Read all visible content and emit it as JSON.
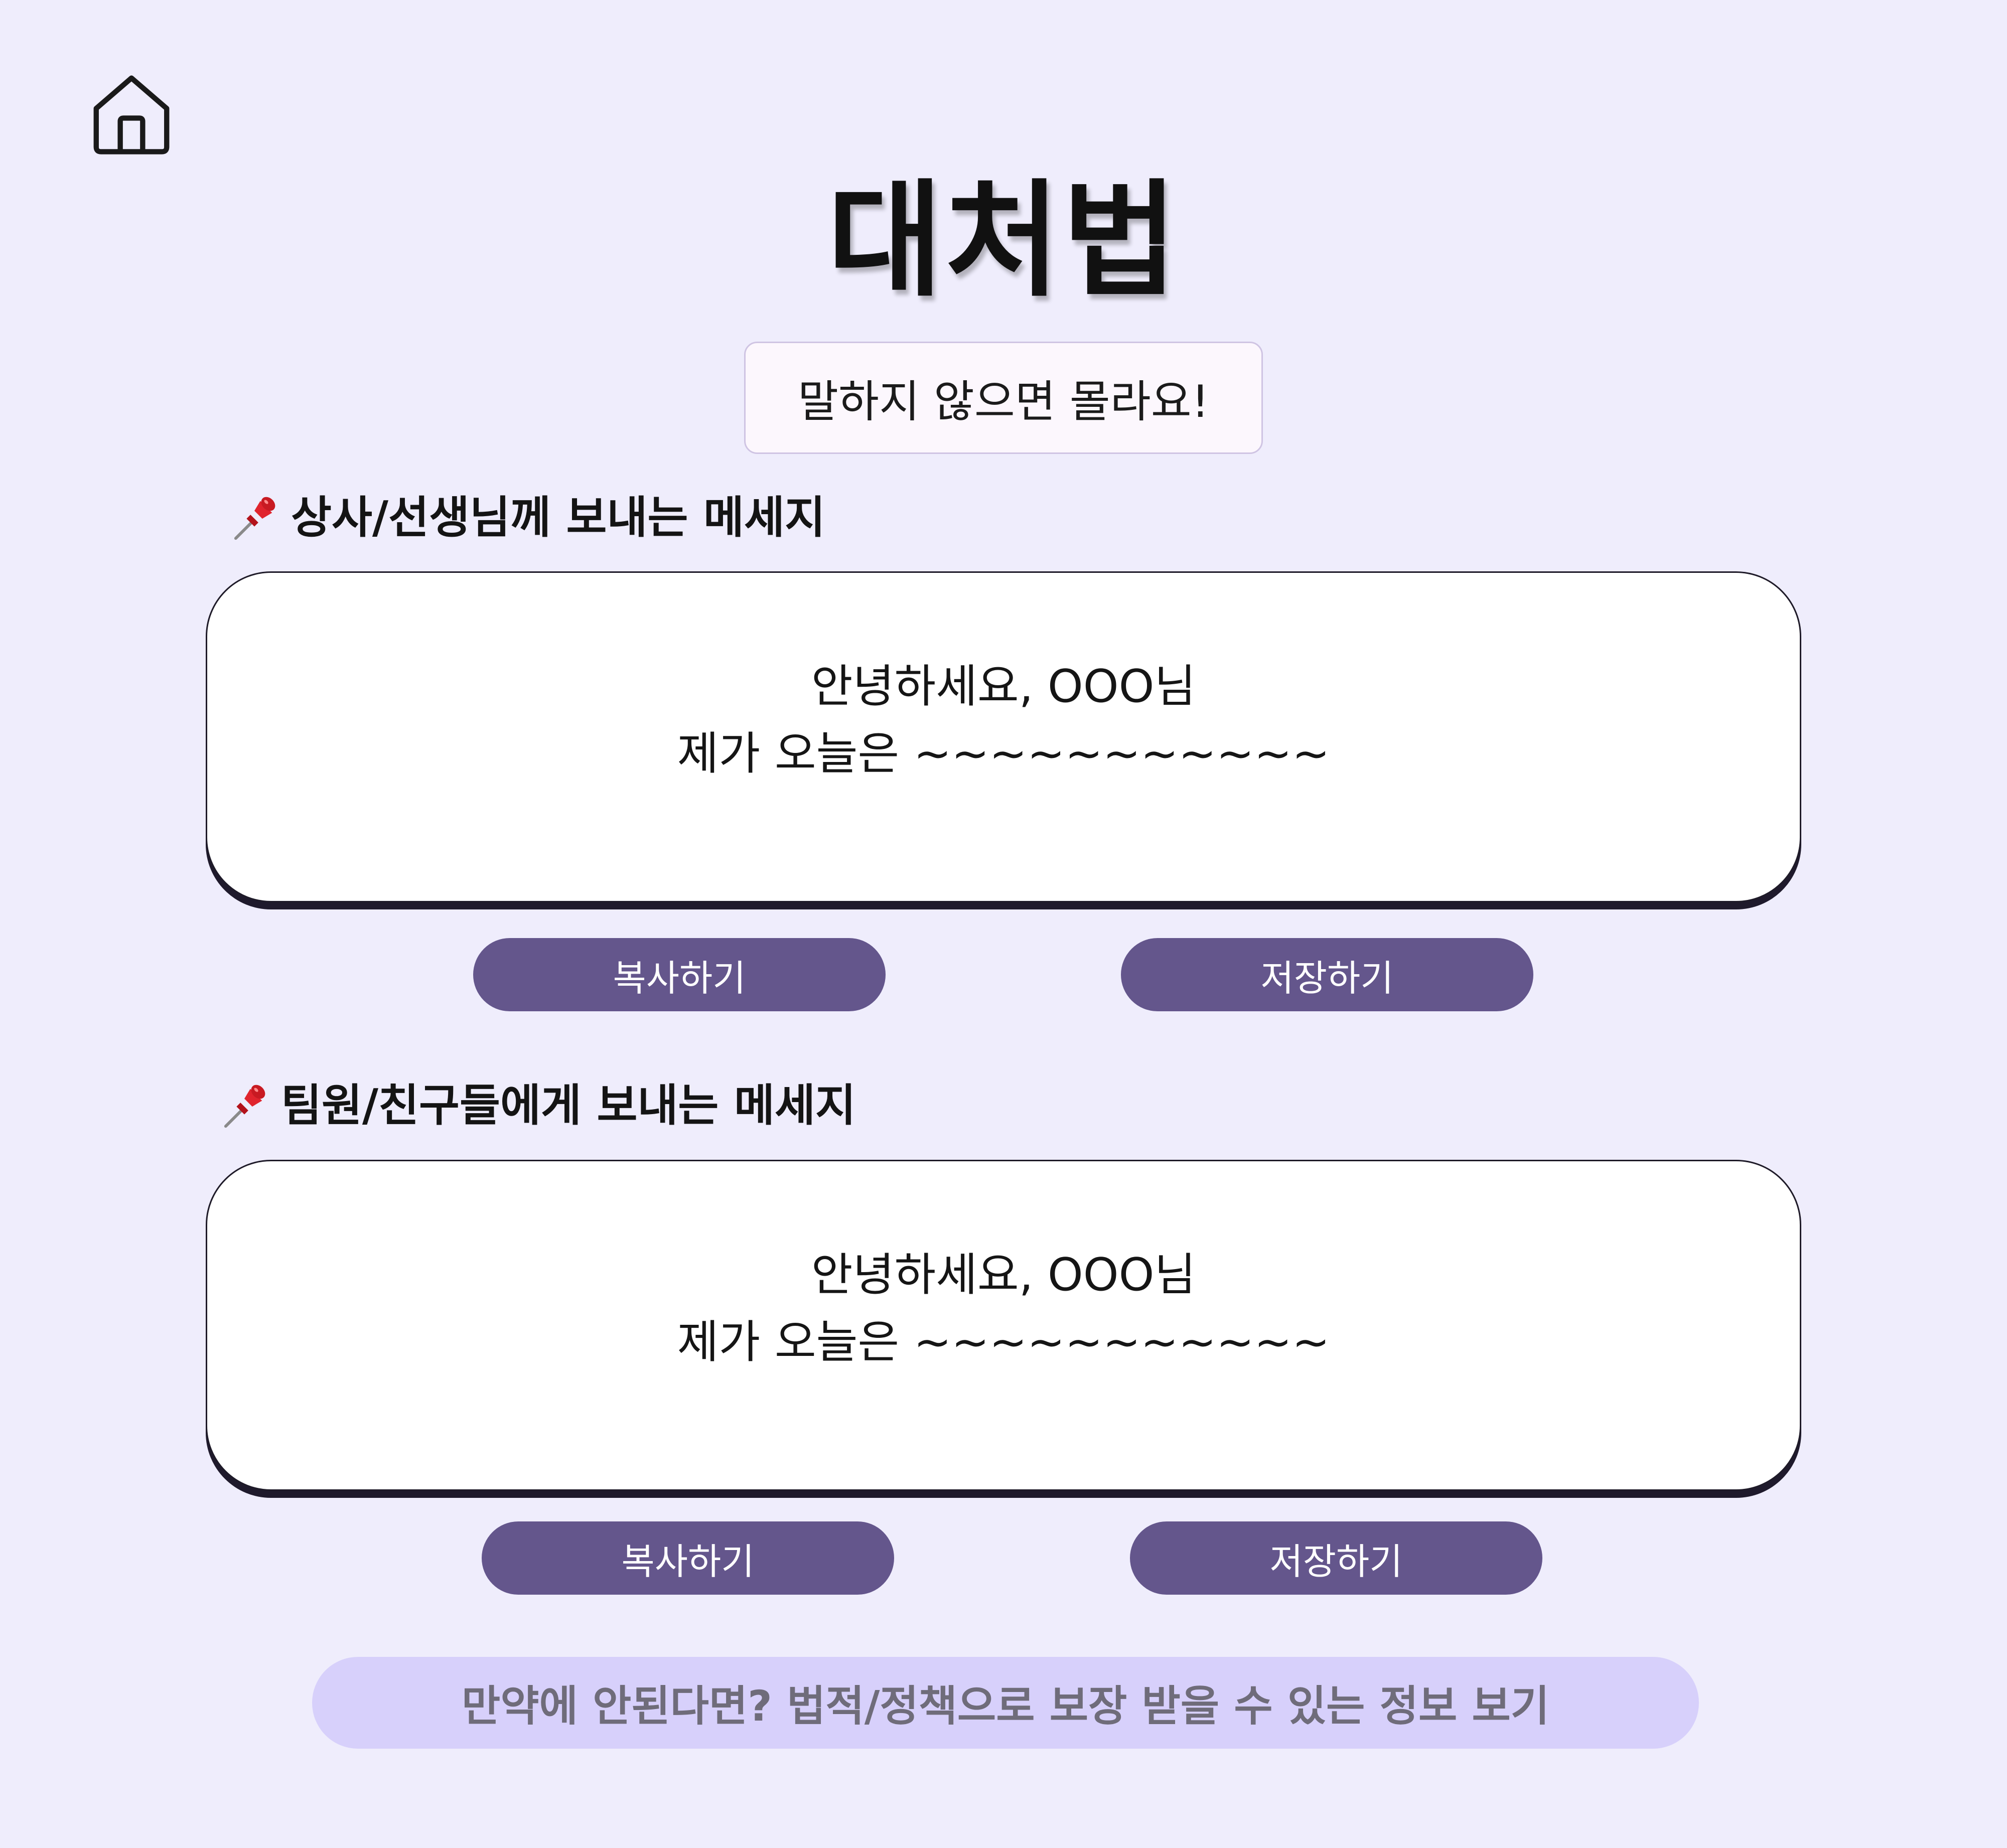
{
  "header": {
    "home_icon": "home-icon",
    "title": "대처법",
    "subtitle": "말하지 않으면 몰라요!"
  },
  "sections": [
    {
      "icon": "pushpin-icon",
      "heading": "상사/선생님께 보내는 메세지",
      "message_lines": [
        "안녕하세요, OOO님",
        "제가 오늘은 ~~~~~~~~~~~"
      ],
      "copy_label": "복사하기",
      "save_label": "저장하기"
    },
    {
      "icon": "pushpin-icon",
      "heading": "팀원/친구들에게 보내는 메세지",
      "message_lines": [
        "안녕하세요, OOO님",
        "제가 오늘은 ~~~~~~~~~~~"
      ],
      "copy_label": "복사하기",
      "save_label": "저장하기"
    }
  ],
  "footer": {
    "info_label": "만약에 안된다면? 법적/정책으로 보장 받을 수 있는 정보 보기"
  },
  "colors": {
    "background": "#efedfc",
    "button": "#64568c",
    "info_button": "#d7d0fb",
    "info_text": "#6f6c7a"
  }
}
